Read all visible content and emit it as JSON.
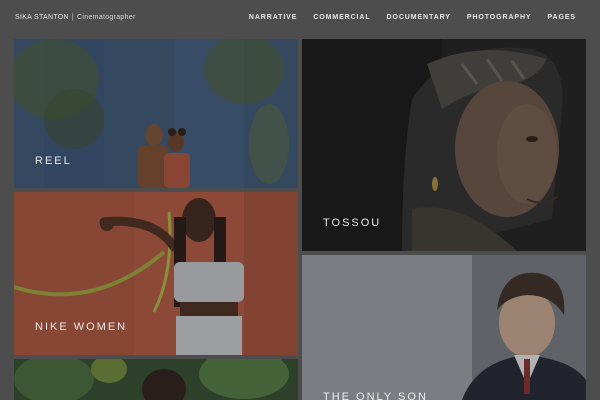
{
  "header": {
    "brand_name": "SIKA STANTON",
    "separator": "|",
    "brand_role": "Cinematographer",
    "nav": [
      "NARRATIVE",
      "COMMERCIAL",
      "DOCUMENTARY",
      "PHOTOGRAPHY",
      "PAGES"
    ]
  },
  "tiles": [
    {
      "title": "REEL"
    },
    {
      "title": "NIKE WOMEN"
    },
    {
      "title": "TOSSOU"
    },
    {
      "title": "THE ONLY SON"
    },
    {
      "title": ""
    }
  ]
}
